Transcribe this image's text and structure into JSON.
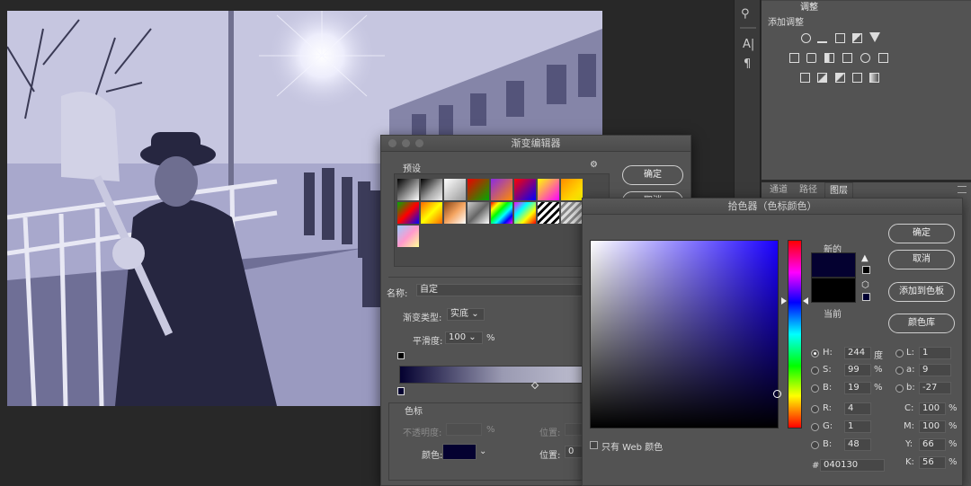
{
  "panels": {
    "adjustments": {
      "tab_label": "调整",
      "title": "添加调整"
    },
    "layers": {
      "tabs": [
        "通道",
        "路径",
        "图层"
      ]
    }
  },
  "gradient_editor": {
    "title": "渐变编辑器",
    "presets_label": "预设",
    "ok_label": "确定",
    "cancel_label": "取消",
    "name_label": "名称:",
    "name_value": "自定",
    "type_label": "渐变类型:",
    "type_value": "实底",
    "smooth_label": "平滑度:",
    "smooth_value": "100",
    "smooth_unit": "%",
    "stops_title": "色标",
    "opacity_label": "不透明度:",
    "opacity_unit": "%",
    "location_label1": "位置:",
    "color_label": "颜色:",
    "location_label2": "位置:",
    "location_value2": "0",
    "stop_color": "#040130"
  },
  "color_picker": {
    "title": "拾色器（色标颜色）",
    "new_label": "新的",
    "current_label": "当前",
    "ok_label": "确定",
    "cancel_label": "取消",
    "add_swatch_label": "添加到色板",
    "library_label": "颜色库",
    "web_only_label": "只有 Web 颜色",
    "hex_label": "#",
    "hex_value": "040130",
    "hsb": {
      "H_label": "H:",
      "H": "244",
      "H_unit": "度",
      "S_label": "S:",
      "S": "99",
      "S_unit": "%",
      "B_label": "B:",
      "B": "19",
      "B_unit": "%"
    },
    "rgb": {
      "R_label": "R:",
      "R": "4",
      "G_label": "G:",
      "G": "1",
      "B_label": "B:",
      "B": "48"
    },
    "lab": {
      "L_label": "L:",
      "L": "1",
      "a_label": "a:",
      "a": "9",
      "b_label": "b:",
      "b": "-27"
    },
    "cmyk": {
      "C_label": "C:",
      "C": "100",
      "M_label": "M:",
      "M": "100",
      "Y_label": "Y:",
      "Y": "66",
      "K_label": "K:",
      "K": "56",
      "unit": "%"
    },
    "new_color": "#040130",
    "current_color": "#000000",
    "field_hue_color": "#1a00ff"
  }
}
